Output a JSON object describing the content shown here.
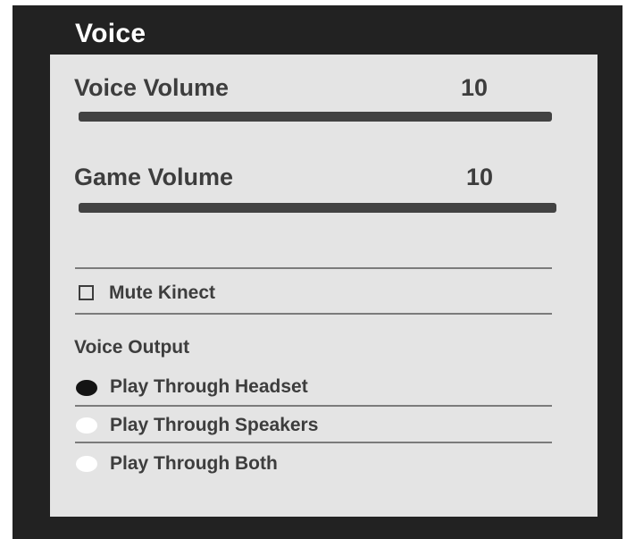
{
  "section_title": "Voice",
  "voice_volume": {
    "label": "Voice Volume",
    "value": "10"
  },
  "game_volume": {
    "label": "Game Volume",
    "value": "10"
  },
  "mute_kinect": {
    "label": "Mute Kinect",
    "checked": false
  },
  "voice_output": {
    "heading": "Voice Output",
    "selected_index": 0,
    "options": [
      {
        "label": "Play Through Headset"
      },
      {
        "label": "Play Through Speakers"
      },
      {
        "label": "Play Through Both"
      }
    ]
  }
}
